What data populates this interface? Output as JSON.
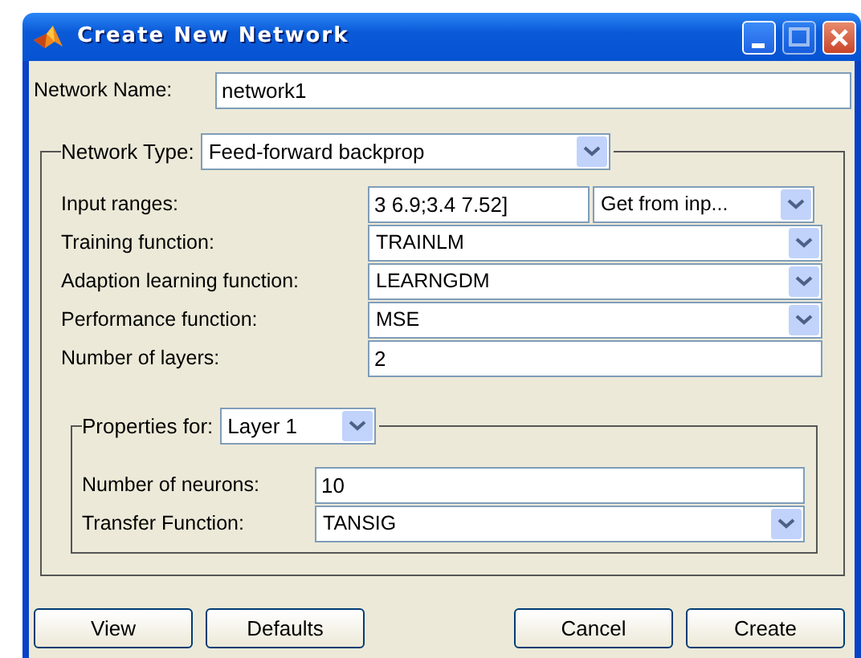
{
  "window": {
    "title": "Create New Network"
  },
  "network_name": {
    "label": "Network Name:",
    "value": "network1"
  },
  "network_type": {
    "label": "Network Type:",
    "value": "Feed-forward backprop"
  },
  "rows": [
    {
      "kind": "text_select",
      "label": "Input ranges:",
      "value": "3 6.9;3.4 7.52]",
      "option": "Get from inp..."
    },
    {
      "kind": "select",
      "label": "Training function:",
      "value": "TRAINLM"
    },
    {
      "kind": "select",
      "label": "Adaption learning function:",
      "value": "LEARNGDM"
    },
    {
      "kind": "select",
      "label": "Performance function:",
      "value": "MSE"
    },
    {
      "kind": "text",
      "label": "Number of layers:",
      "value": "2"
    }
  ],
  "properties": {
    "label": "Properties for:",
    "value": "Layer 1",
    "rows": [
      {
        "kind": "text",
        "label": "Number of neurons:",
        "value": "10"
      },
      {
        "kind": "select",
        "label": "Transfer Function:",
        "value": "TANSIG"
      }
    ]
  },
  "buttons": {
    "left": [
      "View",
      "Defaults"
    ],
    "right": [
      "Cancel",
      "Create"
    ]
  }
}
